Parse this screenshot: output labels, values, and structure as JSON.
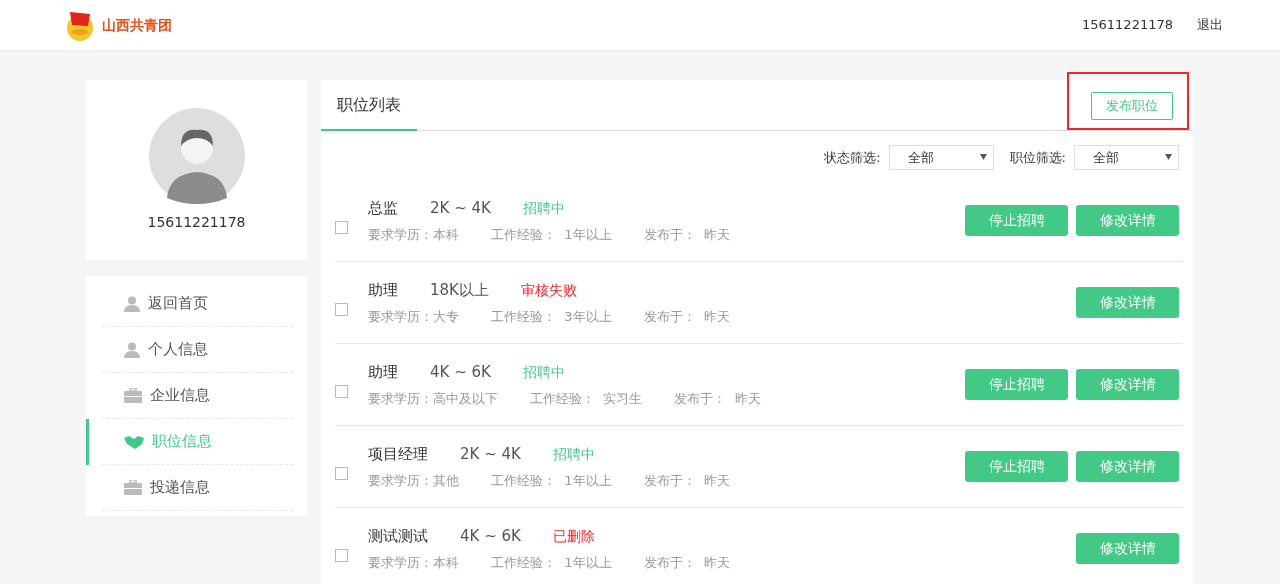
{
  "header": {
    "logo_text": "山西共青团",
    "user": "15611221178",
    "logout": "退出"
  },
  "profile": {
    "phone": "15611221178"
  },
  "menu": [
    {
      "label": "返回首页",
      "kind": "person",
      "selected": false
    },
    {
      "label": "个人信息",
      "kind": "person",
      "selected": false
    },
    {
      "label": "企业信息",
      "kind": "briefcase",
      "selected": false
    },
    {
      "label": "职位信息",
      "kind": "handshake",
      "selected": true
    },
    {
      "label": "投递信息",
      "kind": "briefcase",
      "selected": false
    }
  ],
  "panel": {
    "tab": "职位列表",
    "publish_button": "发布职位",
    "publish_highlighted": true
  },
  "filters": [
    {
      "label": "状态筛选:",
      "value": "全部"
    },
    {
      "label": "职位筛选:",
      "value": "全部"
    }
  ],
  "jobs": [
    {
      "title": "总监",
      "salary": "2K ~ 4K",
      "status": "招聘中",
      "color": "#3ec98a",
      "checked": false,
      "education": "要求学历：本科",
      "experience": "工作经验：  1年以上",
      "posted": "发布于：  昨天",
      "buttons": [
        "停止招聘",
        "修改详情"
      ]
    },
    {
      "title": "助理",
      "salary": "18K以上",
      "status": "审核失败",
      "color": "#f0262b",
      "checked": false,
      "education": "要求学历：大专",
      "experience": "工作经验：  3年以上",
      "posted": "发布于：  昨天",
      "buttons": [
        "修改详情"
      ]
    },
    {
      "title": "助理",
      "salary": "4K ~ 6K",
      "status": "招聘中",
      "color": "#3ec98a",
      "checked": false,
      "education": "要求学历：高中及以下",
      "experience": "工作经验：  实习生",
      "posted": "发布于：  昨天",
      "buttons": [
        "停止招聘",
        "修改详情"
      ]
    },
    {
      "title": "项目经理",
      "salary": "2K ~ 4K",
      "status": "招聘中",
      "color": "#3ec98a",
      "checked": false,
      "education": "要求学历：其他",
      "experience": "工作经验：  1年以上",
      "posted": "发布于：  昨天",
      "buttons": [
        "停止招聘",
        "修改详情"
      ]
    },
    {
      "title": "测试测试",
      "salary": "4K ~ 6K",
      "status": "已删除",
      "color": "#f0262b",
      "checked": false,
      "education": "要求学历：本科",
      "experience": "工作经验：  1年以上",
      "posted": "发布于：  昨天",
      "buttons": [
        "修改详情"
      ]
    }
  ]
}
